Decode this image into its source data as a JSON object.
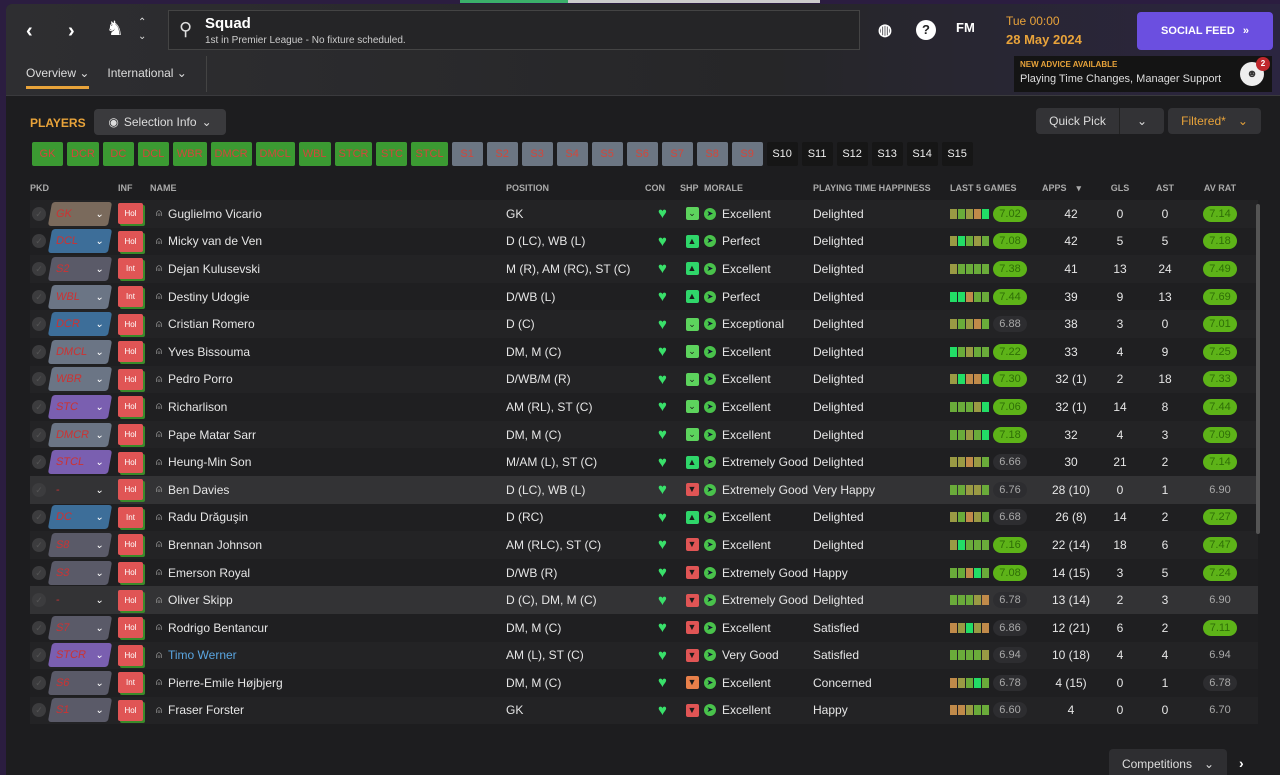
{
  "header": {
    "title": "Squad",
    "subtitle": "1st in Premier League - No fixture scheduled.",
    "fm_label": "FM",
    "time": "Tue 00:00",
    "date": "28 May 2024",
    "social_feed": "SOCIAL FEED",
    "advice_title": "NEW ADVICE AVAILABLE",
    "advice_text": "Playing Time Changes, Manager Support",
    "advice_count": "2"
  },
  "tabs": [
    {
      "label": "Overview",
      "active": true
    },
    {
      "label": "International",
      "active": false
    }
  ],
  "toolbar": {
    "players_label": "PLAYERS",
    "selection_info": "Selection Info",
    "quick_pick": "Quick Pick",
    "filtered": "Filtered*"
  },
  "position_chips": [
    {
      "label": "GK",
      "state": "filled"
    },
    {
      "label": "DCR",
      "state": "filled"
    },
    {
      "label": "DC",
      "state": "filled"
    },
    {
      "label": "DCL",
      "state": "filled"
    },
    {
      "label": "WBR",
      "state": "filled"
    },
    {
      "label": "DMCR",
      "state": "filled"
    },
    {
      "label": "DMCL",
      "state": "filled"
    },
    {
      "label": "WBL",
      "state": "filled"
    },
    {
      "label": "STCR",
      "state": "filled"
    },
    {
      "label": "STC",
      "state": "filled"
    },
    {
      "label": "STCL",
      "state": "filled"
    },
    {
      "label": "S1",
      "state": "sub"
    },
    {
      "label": "S2",
      "state": "sub"
    },
    {
      "label": "S3",
      "state": "sub"
    },
    {
      "label": "S4",
      "state": "sub"
    },
    {
      "label": "S5",
      "state": "sub"
    },
    {
      "label": "S6",
      "state": "sub"
    },
    {
      "label": "S7",
      "state": "sub"
    },
    {
      "label": "S8",
      "state": "sub"
    },
    {
      "label": "S9",
      "state": "sub"
    },
    {
      "label": "S10",
      "state": "empty"
    },
    {
      "label": "S11",
      "state": "empty"
    },
    {
      "label": "S12",
      "state": "empty"
    },
    {
      "label": "S13",
      "state": "empty"
    },
    {
      "label": "S14",
      "state": "empty"
    },
    {
      "label": "S15",
      "state": "empty"
    }
  ],
  "columns": {
    "pkd": "PKD",
    "inf": "INF",
    "name": "NAME",
    "position": "POSITION",
    "con": "CON",
    "shp": "SHP",
    "morale": "MORALE",
    "pth": "PLAYING TIME HAPPINESS",
    "last5": "LAST 5 GAMES",
    "apps": "APPS",
    "gls": "GLS",
    "ast": "AST",
    "avrat": "AV RAT"
  },
  "sort": {
    "column": "APPS",
    "direction": "descending"
  },
  "colors": {
    "accent": "#e8a33a",
    "social": "#6b4fe0",
    "good_rating": "#5db318",
    "chip_filled": "#3b9a32",
    "chip_sub": "#6c7683",
    "inf": "#e05555"
  },
  "rows": [
    {
      "pkd": "GK",
      "pkd_color": "#7a6a5c",
      "inf": "Hol",
      "name": "Guglielmo Vicario",
      "position": "GK",
      "shp": "happy",
      "morale": "Excellent",
      "pth": "Delighted",
      "form": "ogotG",
      "last5": "7.02",
      "apps": "42",
      "gls": "0",
      "ast": "0",
      "avrat": "7.14"
    },
    {
      "pkd": "DCL",
      "pkd_color": "#3d6e99",
      "inf": "Hol",
      "name": "Micky van de Ven",
      "position": "D (LC), WB (L)",
      "shp": "thumbs-up",
      "morale": "Perfect",
      "pth": "Delighted",
      "form": "oGgog",
      "last5": "7.08",
      "apps": "42",
      "gls": "5",
      "ast": "5",
      "avrat": "7.18"
    },
    {
      "pkd": "S2",
      "pkd_color": "#5a5a68",
      "inf": "Int",
      "name": "Dejan Kulusevski",
      "position": "M (R), AM (RC), ST (C)",
      "shp": "thumbs-up",
      "morale": "Excellent",
      "pth": "Delighted",
      "form": "ogggg",
      "last5": "7.38",
      "apps": "41",
      "gls": "13",
      "ast": "24",
      "avrat": "7.49"
    },
    {
      "pkd": "WBL",
      "pkd_color": "#6b7585",
      "inf": "Int",
      "name": "Destiny Udogie",
      "position": "D/WB (L)",
      "shp": "thumbs-up",
      "morale": "Perfect",
      "pth": "Delighted",
      "form": "GGtgg",
      "last5": "7.44",
      "apps": "39",
      "gls": "9",
      "ast": "13",
      "avrat": "7.69"
    },
    {
      "pkd": "DCR",
      "pkd_color": "#3d6e99",
      "inf": "Hol",
      "name": "Cristian Romero",
      "position": "D (C)",
      "shp": "happy",
      "morale": "Exceptional",
      "pth": "Delighted",
      "form": "ogotg",
      "last5": "6.88",
      "apps": "38",
      "gls": "3",
      "ast": "0",
      "avrat": "7.01"
    },
    {
      "pkd": "DMCL",
      "pkd_color": "#6b7585",
      "inf": "Hol",
      "name": "Yves Bissouma",
      "position": "DM, M (C)",
      "shp": "happy",
      "morale": "Excellent",
      "pth": "Delighted",
      "form": "Ggogg",
      "last5": "7.22",
      "apps": "33",
      "gls": "4",
      "ast": "9",
      "avrat": "7.25"
    },
    {
      "pkd": "WBR",
      "pkd_color": "#6b7585",
      "inf": "Hol",
      "name": "Pedro Porro",
      "position": "D/WB/M (R)",
      "shp": "happy",
      "morale": "Excellent",
      "pth": "Delighted",
      "form": "oGttG",
      "last5": "7.30",
      "apps": "32 (1)",
      "gls": "2",
      "ast": "18",
      "avrat": "7.33"
    },
    {
      "pkd": "STC",
      "pkd_color": "#7a5fb0",
      "inf": "Hol",
      "name": "Richarlison",
      "position": "AM (RL), ST (C)",
      "shp": "happy",
      "morale": "Excellent",
      "pth": "Delighted",
      "form": "gggoG",
      "last5": "7.06",
      "apps": "32 (1)",
      "gls": "14",
      "ast": "8",
      "avrat": "7.44"
    },
    {
      "pkd": "DMCR",
      "pkd_color": "#6b7585",
      "inf": "Hol",
      "name": "Pape Matar Sarr",
      "position": "DM, M (C)",
      "shp": "happy",
      "morale": "Excellent",
      "pth": "Delighted",
      "form": "ggogG",
      "last5": "7.18",
      "apps": "32",
      "gls": "4",
      "ast": "3",
      "avrat": "7.09"
    },
    {
      "pkd": "STCL",
      "pkd_color": "#7a5fb0",
      "inf": "Hol",
      "name": "Heung-Min Son",
      "position": "M/AM (L), ST (C)",
      "shp": "thumbs-up",
      "morale": "Extremely Good",
      "pth": "Delighted",
      "form": "ootog",
      "last5": "6.66",
      "apps": "30",
      "gls": "21",
      "ast": "2",
      "avrat": "7.14"
    },
    {
      "pkd": "-",
      "pkd_color": "",
      "inf": "Hol",
      "name": "Ben Davies",
      "position": "D (LC), WB (L)",
      "shp": "thumbs-down",
      "morale": "Extremely Good",
      "pth": "Very Happy",
      "form": "ggoog",
      "last5": "6.76",
      "apps": "28 (10)",
      "gls": "0",
      "ast": "1",
      "avrat": "6.90",
      "highlight": true
    },
    {
      "pkd": "DC",
      "pkd_color": "#3d6e99",
      "inf": "Int",
      "name": "Radu Drăguşin",
      "position": "D (RC)",
      "shp": "thumbs-up",
      "morale": "Excellent",
      "pth": "Delighted",
      "form": "ogtog",
      "last5": "6.68",
      "apps": "26 (8)",
      "gls": "14",
      "ast": "2",
      "avrat": "7.27"
    },
    {
      "pkd": "S8",
      "pkd_color": "#5a5a68",
      "inf": "Hol",
      "name": "Brennan Johnson",
      "position": "AM (RLC), ST (C)",
      "shp": "thumbs-down",
      "morale": "Excellent",
      "pth": "Delighted",
      "form": "oGggg",
      "last5": "7.16",
      "apps": "22 (14)",
      "gls": "18",
      "ast": "6",
      "avrat": "7.47"
    },
    {
      "pkd": "S3",
      "pkd_color": "#5a5a68",
      "inf": "Hol",
      "name": "Emerson Royal",
      "position": "D/WB (R)",
      "shp": "thumbs-down",
      "morale": "Extremely Good",
      "pth": "Happy",
      "form": "ggtGg",
      "last5": "7.08",
      "apps": "14 (15)",
      "gls": "3",
      "ast": "5",
      "avrat": "7.24"
    },
    {
      "pkd": "-",
      "pkd_color": "",
      "inf": "Hol",
      "name": "Oliver Skipp",
      "position": "D (C), DM, M (C)",
      "shp": "thumbs-down",
      "morale": "Extremely Good",
      "pth": "Delighted",
      "form": "gggot",
      "last5": "6.78",
      "apps": "13 (14)",
      "gls": "2",
      "ast": "3",
      "avrat": "6.90",
      "highlight": true
    },
    {
      "pkd": "S7",
      "pkd_color": "#5a5a68",
      "inf": "Hol",
      "name": "Rodrigo Bentancur",
      "position": "DM, M (C)",
      "shp": "thumbs-down",
      "morale": "Excellent",
      "pth": "Satisfied",
      "form": "toGot",
      "last5": "6.86",
      "apps": "12 (21)",
      "gls": "6",
      "ast": "2",
      "avrat": "7.11"
    },
    {
      "pkd": "STCR",
      "pkd_color": "#7a5fb0",
      "inf": "Hol",
      "name": "Timo Werner",
      "name_highlight": true,
      "position": "AM (L), ST (C)",
      "shp": "thumbs-down",
      "morale": "Very Good",
      "pth": "Satisfied",
      "form": "ggggo",
      "last5": "6.94",
      "apps": "10 (18)",
      "gls": "4",
      "ast": "4",
      "avrat": "6.94"
    },
    {
      "pkd": "S6",
      "pkd_color": "#5a5a68",
      "inf": "Int",
      "name": "Pierre-Emile Højbjerg",
      "position": "DM, M (C)",
      "shp": "thumbs-down-orange",
      "morale": "Excellent",
      "pth": "Concerned",
      "form": "togGg",
      "last5": "6.78",
      "apps": "4 (15)",
      "gls": "0",
      "ast": "1",
      "avrat": "6.78"
    },
    {
      "pkd": "S1",
      "pkd_color": "#5a5a68",
      "inf": "Hol",
      "name": "Fraser Forster",
      "position": "GK",
      "shp": "thumbs-down",
      "morale": "Excellent",
      "pth": "Happy",
      "form": "ttogg",
      "last5": "6.60",
      "apps": "4",
      "gls": "0",
      "ast": "0",
      "avrat": "6.70"
    }
  ],
  "footer": {
    "competitions": "Competitions"
  }
}
